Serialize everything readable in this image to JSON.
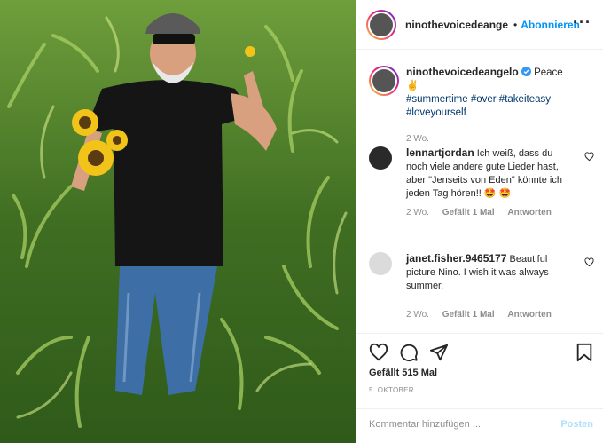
{
  "header": {
    "username": "ninothevoicedeange",
    "follow_label": "Abonnieren",
    "more_icon": "more-dots-icon"
  },
  "caption": {
    "username": "ninothevoicedeangelo",
    "verified_icon": "verified-badge-icon",
    "text": "Peace ✌",
    "hashtags": "#summertime #over #takeiteasy #loveyourself",
    "time": "2 Wo."
  },
  "comments": [
    {
      "username": "lennartjordan",
      "text": "Ich weiß, dass du noch viele andere gute Lieder hast, aber \"Jenseits von Eden\" könnte ich jeden Tag hören!! 🤩 🤩",
      "time": "2 Wo.",
      "likes": "Gefällt 1 Mal",
      "reply": "Antworten"
    },
    {
      "username": "janet.fisher.9465177",
      "text": "Beautiful picture Nino. I wish it was always summer.",
      "time": "2 Wo.",
      "likes": "Gefällt 1 Mal",
      "reply": "Antworten"
    }
  ],
  "actions": {
    "likes": "Gefällt 515 Mal",
    "date": "5. OKTOBER"
  },
  "add_comment": {
    "placeholder": "Kommentar hinzufügen ...",
    "post_label": "Posten"
  },
  "colors": {
    "link": "#0095f6",
    "hashtag": "#00376b",
    "muted": "#8e8e8e"
  }
}
